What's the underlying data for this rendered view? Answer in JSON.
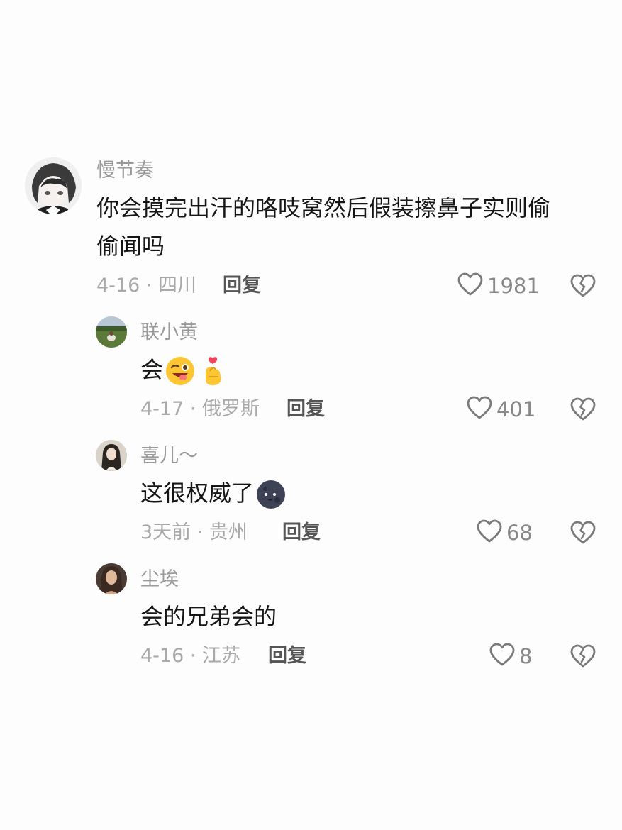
{
  "comments": [
    {
      "username": "慢节奏",
      "text_line1": "你会摸完出汗的咯吱窝然后假装擦鼻子实则偷",
      "text_line2": "偷闻吗",
      "meta": "4-16 · 四川",
      "reply_label": "回复",
      "likes": "1981"
    },
    {
      "username": "联小黄",
      "text": "会",
      "emojis": [
        "wink-tongue-emoji",
        "finger-heart-emoji"
      ],
      "meta": "4-17 · 俄罗斯",
      "reply_label": "回复",
      "likes": "401"
    },
    {
      "username": "喜儿～",
      "text": "这很权威了",
      "emojis": [
        "dark-moon-emoji"
      ],
      "meta": "3天前 · 贵州",
      "reply_label": "回复",
      "likes": "68"
    },
    {
      "username": "尘埃",
      "text": "会的兄弟会的",
      "meta": "4-16 · 江苏",
      "reply_label": "回复",
      "likes": "8"
    }
  ],
  "icons": {
    "like": "heart-outline-icon",
    "dislike": "broken-heart-icon"
  },
  "colors": {
    "username": "#9a9a9a",
    "meta": "#a9a9a9",
    "reply": "#555555",
    "text": "#161616",
    "icon": "#7a7a7a"
  }
}
